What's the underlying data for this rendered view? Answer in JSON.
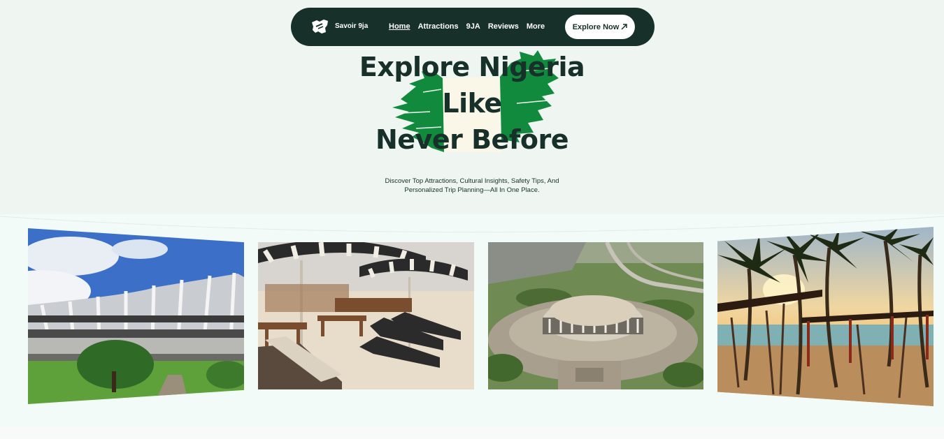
{
  "nav": {
    "brand": "Savoir 9ja",
    "links": [
      {
        "label": "Home",
        "active": true
      },
      {
        "label": "Attractions",
        "active": false
      },
      {
        "label": "9JA",
        "active": false
      },
      {
        "label": "Reviews",
        "active": false
      },
      {
        "label": "More",
        "active": false
      }
    ],
    "cta_label": "Explore Now",
    "cta_icon": "arrow-up-right-icon"
  },
  "hero": {
    "headline_line1": "Explore Nigeria",
    "headline_line2": "Like",
    "headline_line3": "Never Before",
    "subtitle_line1": "Discover Top Attractions, Cultural Insights, Safety Tips, And",
    "subtitle_line2": "Personalized Trip Planning—All In One Place."
  },
  "colors": {
    "background": "#eff6f2",
    "nav": "#17302a",
    "flag_green": "#118a3e",
    "flag_white": "#faf7e8"
  },
  "gallery": [
    {
      "name": "national-theatre-photo"
    },
    {
      "name": "beach-lounge-photo"
    },
    {
      "name": "aerial-theatre-photo"
    },
    {
      "name": "palm-beach-sunset-photo"
    }
  ]
}
